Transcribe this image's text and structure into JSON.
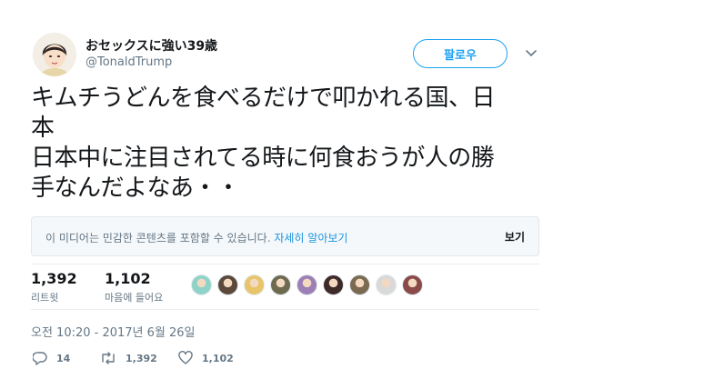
{
  "user": {
    "display_name": "おセックスに強い39歳",
    "handle": "@TonaldTrump"
  },
  "follow_button": {
    "label": "팔로우"
  },
  "tweet": {
    "lines": [
      "キムチうどんを食べるだけで叩かれる国、日",
      "本",
      "日本中に注目されてる時に何食おうが人の勝",
      "手なんだよなあ・・"
    ]
  },
  "media_notice": {
    "message": "이 미디어는 민감한 콘텐츠를 포함할 수 있습니다.",
    "learn_more": "자세히 알아보기",
    "view_label": "보기"
  },
  "stats": {
    "retweets": {
      "value": "1,392",
      "label": "리트윗"
    },
    "likes": {
      "value": "1,102",
      "label": "마음에 들어요"
    }
  },
  "liker_avatars": [
    {
      "color": "#8fd3c8"
    },
    {
      "color": "#5b4a3c"
    },
    {
      "color": "#e8c56a"
    },
    {
      "color": "#6e6a4f"
    },
    {
      "color": "#9c7fb5"
    },
    {
      "color": "#3f2a2a"
    },
    {
      "color": "#7a6a52"
    },
    {
      "color": "#d9d9d9"
    },
    {
      "color": "#8a4a4a"
    }
  ],
  "timestamp": "오전 10:20 - 2017년 6월 26일",
  "actions": {
    "replies": "14",
    "retweets": "1,392",
    "likes": "1,102"
  },
  "colors": {
    "accent": "#1da1f2",
    "link": "#1b95e0",
    "muted": "#657786"
  }
}
